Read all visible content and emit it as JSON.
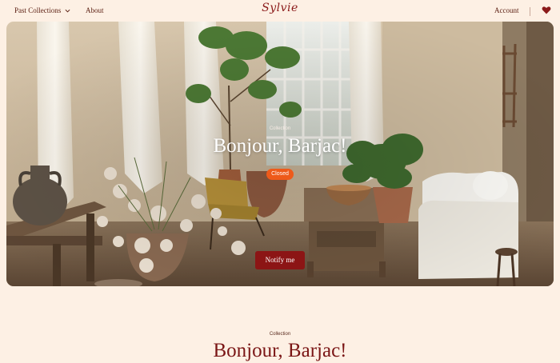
{
  "nav": {
    "past_collections": "Past Collections",
    "about": "About",
    "logo": "Sylvie",
    "account": "Account"
  },
  "hero": {
    "eyebrow": "Collection",
    "title": "Bonjour, Barjac!",
    "status": "Closed",
    "cta": "Notify me"
  },
  "section": {
    "eyebrow": "Collection",
    "title": "Bonjour, Barjac!"
  },
  "colors": {
    "background": "#fdf0e4",
    "brand": "#8b1a1a",
    "status_badge": "#ee5a1a",
    "cta": "#8c1515"
  },
  "icons": {
    "dropdown": "chevron-down-icon",
    "wishlist": "heart-icon"
  }
}
